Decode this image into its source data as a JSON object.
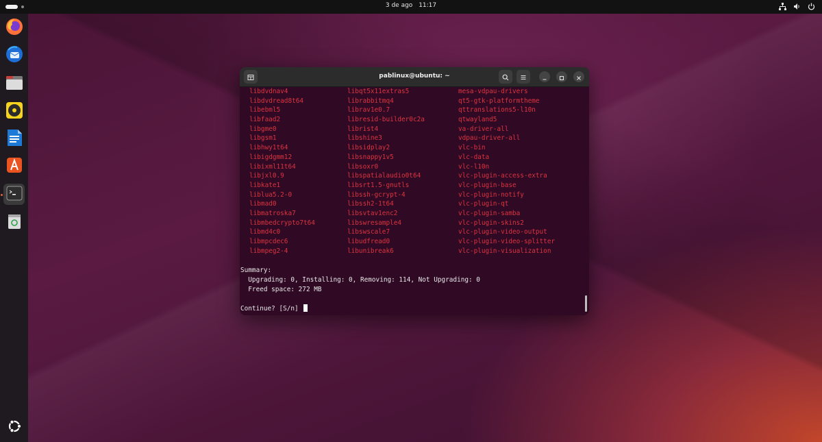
{
  "topbar": {
    "date": "3 de ago",
    "time": "11:17",
    "tray_icons": [
      "network-icon",
      "volume-icon",
      "power-icon"
    ]
  },
  "dock": {
    "apps": [
      {
        "name": "firefox",
        "icon": "firefox-icon",
        "running": false
      },
      {
        "name": "thunderbird",
        "icon": "thunderbird-icon",
        "running": false
      },
      {
        "name": "files",
        "icon": "files-icon",
        "running": false
      },
      {
        "name": "rhythmbox",
        "icon": "rhythmbox-icon",
        "running": false
      },
      {
        "name": "libreoffice-writer",
        "icon": "writer-icon",
        "running": false
      },
      {
        "name": "app-center",
        "icon": "app-center-icon",
        "running": false
      },
      {
        "name": "terminal",
        "icon": "terminal-icon",
        "running": true
      },
      {
        "name": "trash",
        "icon": "trash-icon",
        "running": false
      }
    ],
    "show_apps_icon": "ubuntu-logo-icon"
  },
  "terminal": {
    "title": "pablinux@ubuntu: ~",
    "packages": [
      [
        "libdvdnav4",
        "libqt5x11extras5",
        "mesa-vdpau-drivers"
      ],
      [
        "libdvdread8t64",
        "librabbitmq4",
        "qt5-gtk-platformtheme"
      ],
      [
        "libebml5",
        "librav1e0.7",
        "qttranslations5-l10n"
      ],
      [
        "libfaad2",
        "libresid-builder0c2a",
        "qtwayland5"
      ],
      [
        "libgme0",
        "librist4",
        "va-driver-all"
      ],
      [
        "libgsm1",
        "libshine3",
        "vdpau-driver-all"
      ],
      [
        "libhwy1t64",
        "libsidplay2",
        "vlc-bin"
      ],
      [
        "libigdgmm12",
        "libsnappy1v5",
        "vlc-data"
      ],
      [
        "libixml11t64",
        "libsoxr0",
        "vlc-l10n"
      ],
      [
        "libjxl0.9",
        "libspatialaudio0t64",
        "vlc-plugin-access-extra"
      ],
      [
        "libkate1",
        "libsrt1.5-gnutls",
        "vlc-plugin-base"
      ],
      [
        "liblua5.2-0",
        "libssh-gcrypt-4",
        "vlc-plugin-notify"
      ],
      [
        "libmad0",
        "libssh2-1t64",
        "vlc-plugin-qt"
      ],
      [
        "libmatroska7",
        "libsvtav1enc2",
        "vlc-plugin-samba"
      ],
      [
        "libmbedcrypto7t64",
        "libswresample4",
        "vlc-plugin-skins2"
      ],
      [
        "libmd4c0",
        "libswscale7",
        "vlc-plugin-video-output"
      ],
      [
        "libmpcdec6",
        "libudfread0",
        "vlc-plugin-video-splitter"
      ],
      [
        "libmpeg2-4",
        "libunibreak6",
        "vlc-plugin-visualization"
      ]
    ],
    "summary_label": "Summary:",
    "summary_counts": "  Upgrading: 0, Installing: 0, Removing: 114, Not Upgrading: 0",
    "freed_space": "  Freed space: 272 MB",
    "prompt": "Continue? [S/n] ",
    "package_color": "#dd3340",
    "background_color": "#300a24"
  }
}
